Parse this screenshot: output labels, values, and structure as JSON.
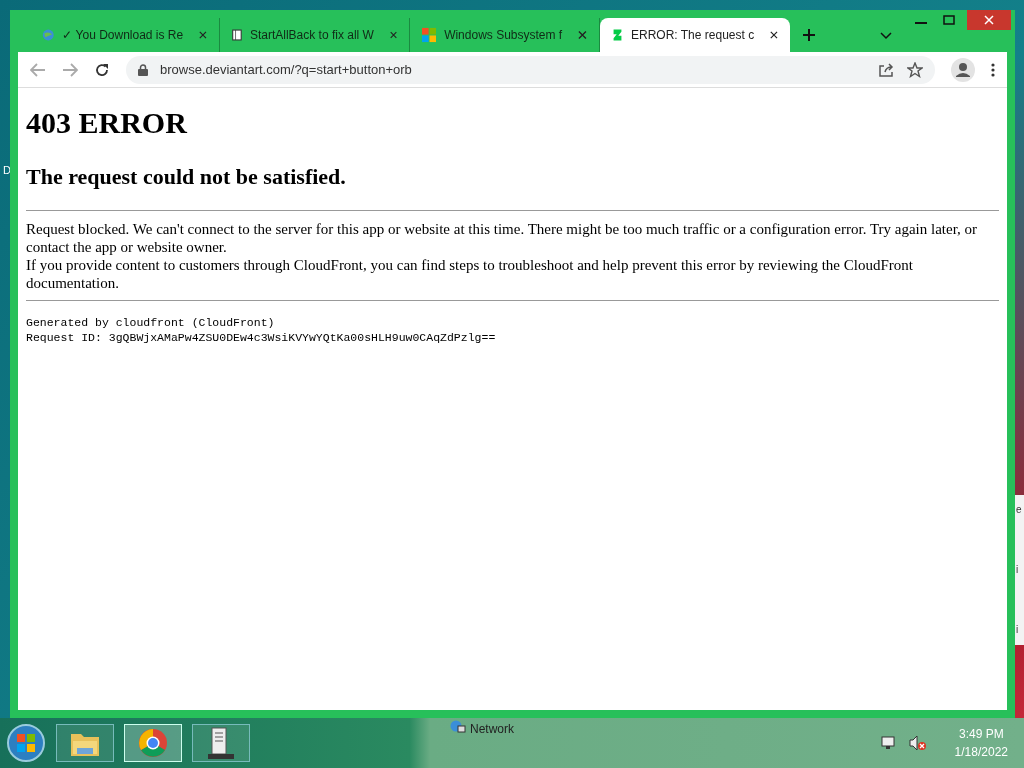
{
  "desktop": {
    "left_fragment": "D",
    "right_fragments": [
      "e",
      "i",
      "i"
    ]
  },
  "tabs": [
    {
      "title": "✓ You Download is Re",
      "kind": "globe",
      "selected": false
    },
    {
      "title": "StartAllBack to fix all W",
      "kind": "book",
      "selected": false
    },
    {
      "title": "Windows Subsystem f",
      "kind": "windows",
      "selected": false
    },
    {
      "title": "ERROR: The request c",
      "kind": "deviantart",
      "selected": true
    }
  ],
  "address": {
    "url": "browse.deviantart.com/?q=start+button+orb"
  },
  "page": {
    "title": "403 ERROR",
    "subtitle": "The request could not be satisfied.",
    "paragraphs": [
      "Request blocked. We can't connect to the server for this app or website at this time. There might be too much traffic or a configuration error. Try again later, or contact the app or website owner.",
      "If you provide content to customers through CloudFront, you can find steps to troubleshoot and help prevent this error by reviewing the CloudFront documentation."
    ],
    "footer_lines": [
      "Generated by cloudfront (CloudFront)",
      "Request ID: 3gQBWjxAMaPw4ZSU0DEw4c3WsiKVYwYQtKa00sHLH9uw0CAqZdPzlg=="
    ]
  },
  "taskbar": {
    "apps": [
      {
        "kind": "folder",
        "selected": false
      },
      {
        "kind": "chrome",
        "selected": true
      },
      {
        "kind": "server",
        "selected": false
      }
    ],
    "background_label": "Network",
    "time": "3:49 PM",
    "date": "1/18/2022"
  }
}
